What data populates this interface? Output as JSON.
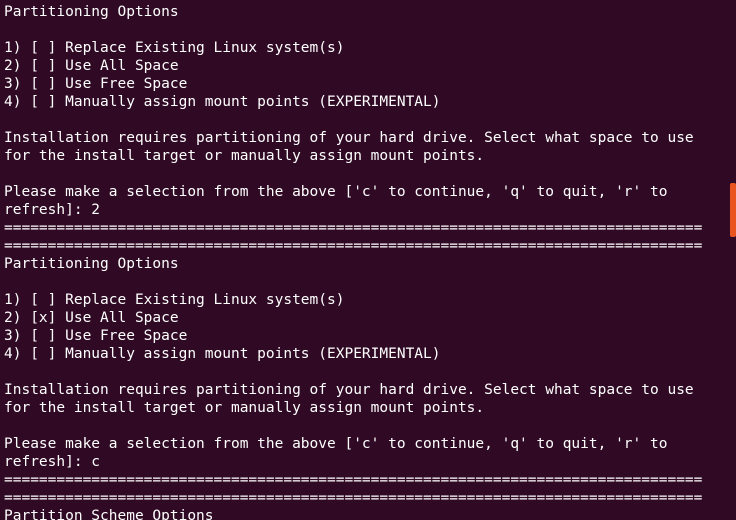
{
  "terminal": {
    "lines": [
      "Partitioning Options",
      "",
      "1) [ ] Replace Existing Linux system(s)",
      "2) [ ] Use All Space",
      "3) [ ] Use Free Space",
      "4) [ ] Manually assign mount points (EXPERIMENTAL)",
      "",
      "Installation requires partitioning of your hard drive. Select what space to use",
      "for the install target or manually assign mount points.",
      "",
      "Please make a selection from the above ['c' to continue, 'q' to quit, 'r' to",
      "refresh]: 2",
      "================================================================================",
      "================================================================================",
      "Partitioning Options",
      "",
      "1) [ ] Replace Existing Linux system(s)",
      "2) [x] Use All Space",
      "3) [ ] Use Free Space",
      "4) [ ] Manually assign mount points (EXPERIMENTAL)",
      "",
      "Installation requires partitioning of your hard drive. Select what space to use",
      "for the install target or manually assign mount points.",
      "",
      "Please make a selection from the above ['c' to continue, 'q' to quit, 'r' to",
      "refresh]: c",
      "================================================================================",
      "================================================================================",
      "Partition Scheme Options"
    ]
  },
  "colors": {
    "background": "#300a24",
    "text": "#ffffff",
    "scrollbar": "#e95420"
  }
}
